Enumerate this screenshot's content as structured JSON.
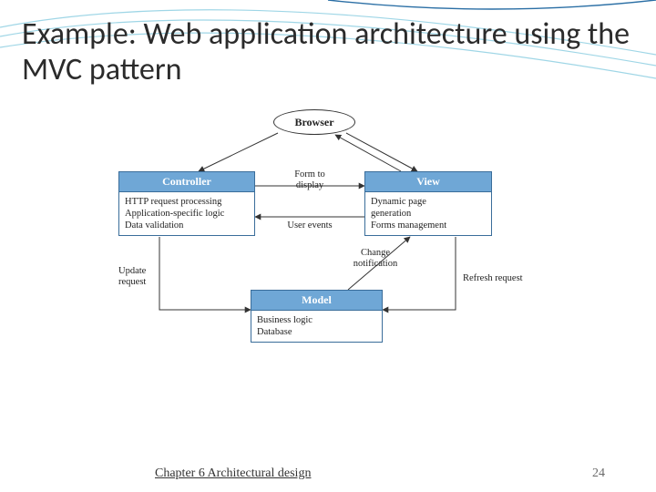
{
  "title": "Example: Web application architecture using the MVC pattern",
  "footer": {
    "chapter": "Chapter 6 Architectural design",
    "page": "24"
  },
  "diagram": {
    "browser": {
      "label": "Browser"
    },
    "controller": {
      "title": "Controller",
      "body": "HTTP request processing\nApplication-specific logic\nData validation"
    },
    "view": {
      "title": "View",
      "body": "Dynamic page\ngeneration\nForms management"
    },
    "model": {
      "title": "Model",
      "body": "Business logic\nDatabase"
    },
    "edges": {
      "form_to_display": "Form to\ndisplay",
      "user_events": "User events",
      "change_notification": "Change\nnotification",
      "refresh_request": "Refresh request",
      "update_request": "Update\nrequest"
    }
  }
}
